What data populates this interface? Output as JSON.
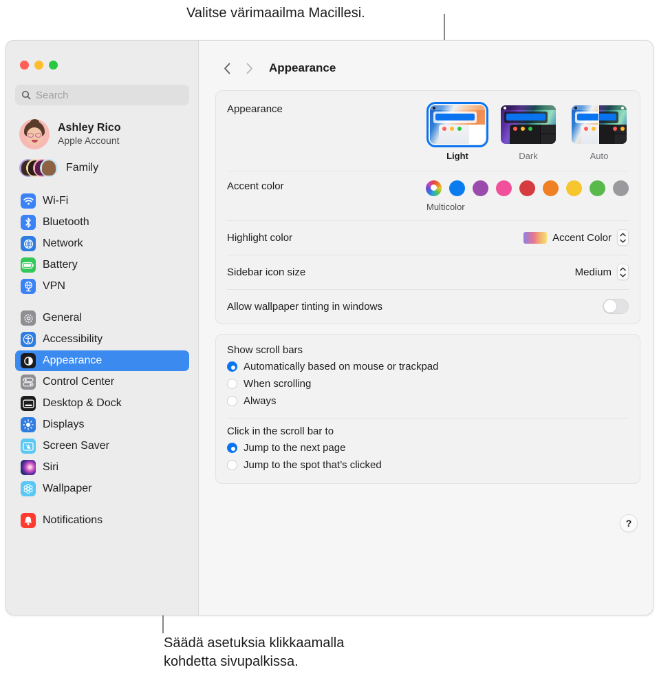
{
  "callouts": {
    "top": "Valitse värimaailma Macillesi.",
    "bottom_line1": "Säädä asetuksia klikkaamalla",
    "bottom_line2": "kohdetta sivupalkissa."
  },
  "window": {
    "traffic_lights": [
      "close-red",
      "minimize-yellow",
      "zoom-green"
    ]
  },
  "search": {
    "placeholder": "Search",
    "value": ""
  },
  "account": {
    "name": "Ashley Rico",
    "subtitle": "Apple Account",
    "family_label": "Family"
  },
  "sidebar": {
    "groups": [
      {
        "items": [
          {
            "label": "Wi-Fi",
            "icon": "wifi-icon",
            "color": "#3b82f6",
            "selected": false
          },
          {
            "label": "Bluetooth",
            "icon": "bluetooth-icon",
            "color": "#3b82f6",
            "selected": false
          },
          {
            "label": "Network",
            "icon": "globe-icon",
            "color": "#2f7de0",
            "selected": false
          },
          {
            "label": "Battery",
            "icon": "battery-icon",
            "color": "#34c759",
            "selected": false
          },
          {
            "label": "VPN",
            "icon": "vpn-globe-icon",
            "color": "#3b82f6",
            "selected": false
          }
        ]
      },
      {
        "items": [
          {
            "label": "General",
            "icon": "gear-icon",
            "color": "#8e8e93",
            "selected": false
          },
          {
            "label": "Accessibility",
            "icon": "accessibility-icon",
            "color": "#2f7de0",
            "selected": false
          },
          {
            "label": "Appearance",
            "icon": "appearance-icon",
            "color": "#1c1c1e",
            "selected": true
          },
          {
            "label": "Control Center",
            "icon": "control-center-icon",
            "color": "#8e8e93",
            "selected": false
          },
          {
            "label": "Desktop & Dock",
            "icon": "desktop-dock-icon",
            "color": "#1c1c1e",
            "selected": false
          },
          {
            "label": "Displays",
            "icon": "displays-icon",
            "color": "#2f7de0",
            "selected": false
          },
          {
            "label": "Screen Saver",
            "icon": "screen-saver-icon",
            "color": "#5ac8f5",
            "selected": false
          },
          {
            "label": "Siri",
            "icon": "siri-icon",
            "color": "#1c1c1e",
            "selected": false
          },
          {
            "label": "Wallpaper",
            "icon": "wallpaper-icon",
            "color": "#5ac8f5",
            "selected": false
          }
        ]
      },
      {
        "items": [
          {
            "label": "Notifications",
            "icon": "notifications-icon",
            "color": "#ff3b30",
            "selected": false
          }
        ]
      }
    ]
  },
  "toolbar": {
    "back_icon": "chevron-left-icon",
    "forward_icon": "chevron-right-icon",
    "title": "Appearance"
  },
  "appearance": {
    "label": "Appearance",
    "themes": [
      {
        "label": "Light",
        "selected": true
      },
      {
        "label": "Dark",
        "selected": false
      },
      {
        "label": "Auto",
        "selected": false
      }
    ]
  },
  "accent_color": {
    "label": "Accent color",
    "selected_label": "Multicolor",
    "swatches": [
      {
        "name": "Multicolor",
        "color": "multicolor",
        "selected": true
      },
      {
        "name": "Blue",
        "color": "#0a7cf0",
        "selected": false
      },
      {
        "name": "Purple",
        "color": "#9a4bab",
        "selected": false
      },
      {
        "name": "Pink",
        "color": "#f0519a",
        "selected": false
      },
      {
        "name": "Red",
        "color": "#d63b3f",
        "selected": false
      },
      {
        "name": "Orange",
        "color": "#ef8023",
        "selected": false
      },
      {
        "name": "Yellow",
        "color": "#f7c52e",
        "selected": false
      },
      {
        "name": "Green",
        "color": "#5ab94b",
        "selected": false
      },
      {
        "name": "Graphite",
        "color": "#9a9a9e",
        "selected": false
      }
    ]
  },
  "highlight_color": {
    "label": "Highlight color",
    "value": "Accent Color"
  },
  "sidebar_icon_size": {
    "label": "Sidebar icon size",
    "value": "Medium"
  },
  "wallpaper_tinting": {
    "label": "Allow wallpaper tinting in windows",
    "enabled": false
  },
  "show_scroll_bars": {
    "label": "Show scroll bars",
    "options": [
      {
        "label": "Automatically based on mouse or trackpad",
        "selected": true
      },
      {
        "label": "When scrolling",
        "selected": false
      },
      {
        "label": "Always",
        "selected": false
      }
    ]
  },
  "click_scroll_bar": {
    "label": "Click in the scroll bar to",
    "options": [
      {
        "label": "Jump to the next page",
        "selected": true
      },
      {
        "label": "Jump to the spot that’s clicked",
        "selected": false
      }
    ]
  },
  "help": {
    "label": "?"
  },
  "colors": {
    "accent_blue": "#3b8aef",
    "selection_blue": "#0a74f0",
    "window_bg": "#ececec",
    "detail_bg": "#f6f6f6",
    "card_bg": "#f2f2f2"
  }
}
